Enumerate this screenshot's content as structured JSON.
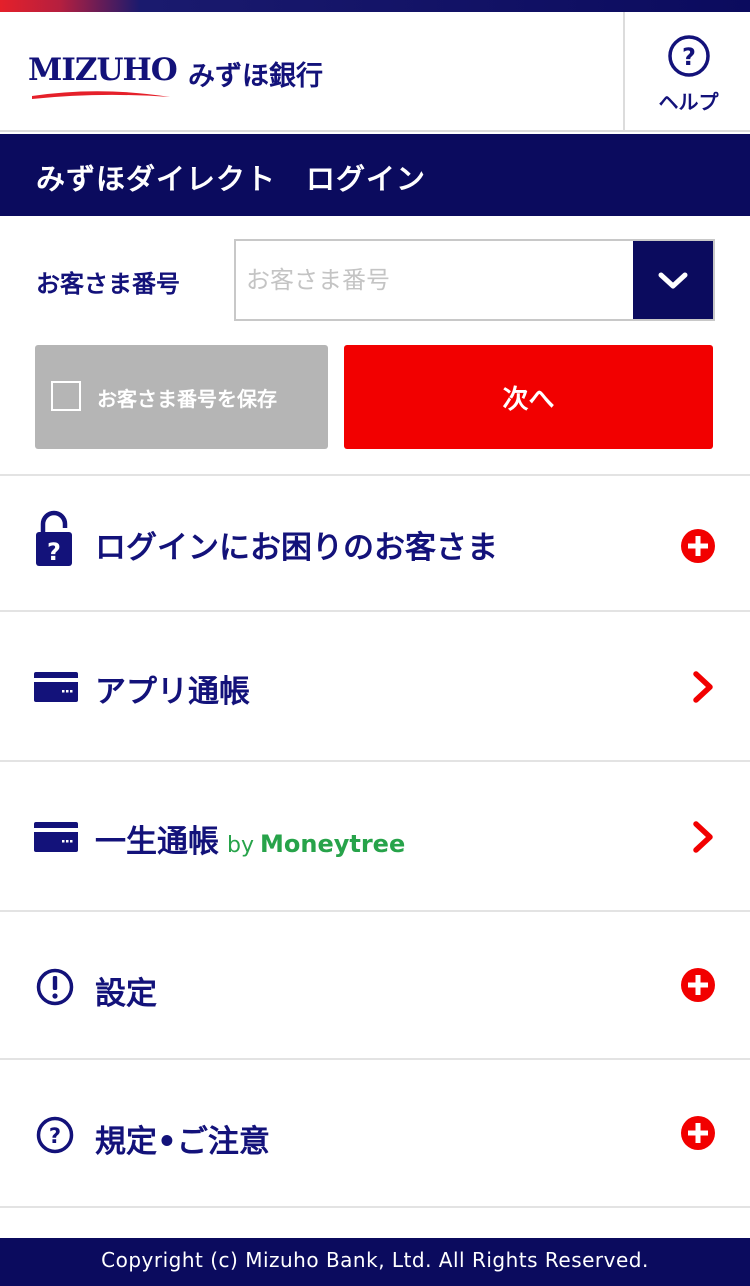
{
  "header": {
    "logo_text": "MIZUHO",
    "bank_name": "みずほ銀行",
    "help_label": "ヘルプ"
  },
  "title_bar": {
    "title": "みずほダイレクト　ログイン"
  },
  "login": {
    "customer_number_label": "お客さま番号",
    "customer_number_placeholder": "お客さま番号",
    "customer_number_value": "",
    "save_number_label": "お客さま番号を保存",
    "save_number_checked": false,
    "next_button_label": "次へ"
  },
  "menu": {
    "items": [
      {
        "label": "ログインにお困りのお客さま",
        "icon": "lock-question-icon",
        "action": "expand-plus-icon"
      },
      {
        "label": "アプリ通帳",
        "icon": "card-icon",
        "action": "chevron-right-icon"
      },
      {
        "label": "一生通帳",
        "by": "by",
        "brand": "Moneytree",
        "icon": "card-icon",
        "action": "chevron-right-icon"
      },
      {
        "label": "設定",
        "icon": "exclamation-circle-icon",
        "action": "expand-plus-icon"
      },
      {
        "label": "規定•ご注意",
        "icon": "question-circle-icon",
        "action": "expand-plus-icon"
      }
    ]
  },
  "footer": {
    "copyright": "Copyright (c) Mizuho Bank, Ltd. All Rights Reserved."
  },
  "colors": {
    "navy": "#0b0b5e",
    "text_navy": "#13127a",
    "accent_red": "#f20000",
    "moneytree_green": "#27a34a",
    "disabled_gray": "#b5b5b5"
  }
}
